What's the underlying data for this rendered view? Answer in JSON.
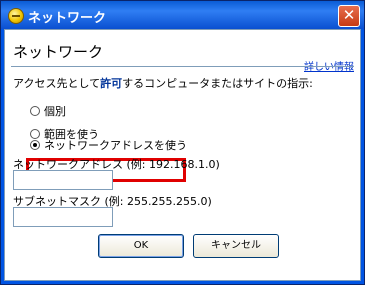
{
  "window": {
    "title": "ネットワーク"
  },
  "header": {
    "heading": "ネットワーク",
    "more_info": "詳しい情報"
  },
  "instruction": {
    "prefix": "アクセス先として",
    "emphasis": "許可",
    "suffix": "するコンピュータまたはサイトの指示:"
  },
  "options": [
    {
      "label": "個別",
      "selected": false
    },
    {
      "label": "範囲を使う",
      "selected": false
    },
    {
      "label": "ネットワークアドレスを使う",
      "selected": true
    }
  ],
  "fields": {
    "network_address_label": "ネットワークアドレス (例: 192.168.1.0)",
    "network_address_value": "",
    "subnet_mask_label": "サブネットマスク (例: 255.255.255.0)",
    "subnet_mask_value": ""
  },
  "buttons": {
    "ok": "OK",
    "cancel": "キャンセル"
  },
  "colors": {
    "highlight": "#e00000",
    "link": "#0033cc",
    "titlebar": "#0a5cd6"
  }
}
